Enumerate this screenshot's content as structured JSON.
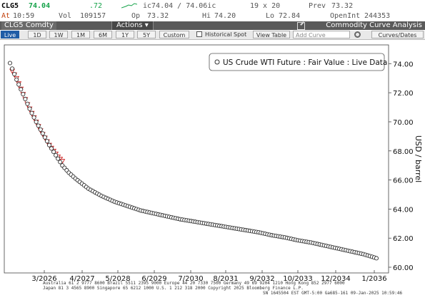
{
  "quote": {
    "ticker": "CLG5",
    "last": "74.04",
    "change": ".72",
    "ic_range": "ic74.04 / 74.06ic",
    "size": "19 x 20",
    "prev_label": "Prev",
    "prev_value": "73.32",
    "at_label": "At",
    "at_value": "10:59",
    "vol_label": "Vol",
    "vol_value": "109157",
    "op_label": "Op",
    "op_value": "73.32",
    "hi_label": "Hi",
    "hi_value": "74.20",
    "lo_label": "Lo",
    "lo_value": "72.84",
    "oi_label": "OpenInt",
    "oi_value": "244353"
  },
  "titlebar": {
    "security": "CLG5 Comdty",
    "actions": "Actions ▾",
    "app_title": "Commodity Curve Analysis"
  },
  "toolbar": {
    "periods": [
      "Live",
      "1D",
      "1W",
      "1M",
      "6M",
      "1Y",
      "5Y",
      "Custom"
    ],
    "active_period": "Live",
    "historical_spot": "Historical Spot",
    "view_table": "View Table",
    "add_curve_placeholder": "Add Curve",
    "curves_dates": "Curves/Dates"
  },
  "colors": {
    "live_marker": "#333333",
    "historical_marker": "#cc2222",
    "active_button": "#1f5ca6",
    "last_price": "#16a34a"
  },
  "chart_data": {
    "type": "line",
    "ylabel": "USD / barrel",
    "ylim": [
      60,
      74.8
    ],
    "yticks": [
      "60.00",
      "62.00",
      "64.00",
      "66.00",
      "68.00",
      "70.00",
      "72.00",
      "74.00"
    ],
    "xticks": [
      "3/2026",
      "4/2027",
      "5/2028",
      "6/2029",
      "7/2030",
      "8/2031",
      "9/2032",
      "10/2033",
      "12/2034",
      "1/2036"
    ],
    "grid": false,
    "legend_position": "top-right",
    "series": [
      {
        "name": "US Crude WTI Future : Fair Value : Live Data",
        "marker": "circle",
        "points": [
          [
            0,
            74.04
          ],
          [
            3,
            72.9
          ],
          [
            6,
            71.9
          ],
          [
            9,
            70.9
          ],
          [
            12,
            70.0
          ],
          [
            15,
            69.2
          ],
          [
            18,
            68.4
          ],
          [
            21,
            67.7
          ],
          [
            24,
            67.0
          ],
          [
            27,
            66.5
          ],
          [
            30,
            66.1
          ],
          [
            36,
            65.4
          ],
          [
            42,
            64.9
          ],
          [
            48,
            64.5
          ],
          [
            54,
            64.2
          ],
          [
            60,
            63.9
          ],
          [
            66,
            63.7
          ],
          [
            72,
            63.5
          ],
          [
            78,
            63.3
          ],
          [
            84,
            63.15
          ],
          [
            90,
            63.0
          ],
          [
            96,
            62.85
          ],
          [
            102,
            62.7
          ],
          [
            108,
            62.55
          ],
          [
            114,
            62.4
          ],
          [
            120,
            62.2
          ],
          [
            126,
            62.05
          ],
          [
            132,
            61.85
          ],
          [
            138,
            61.7
          ],
          [
            144,
            61.5
          ],
          [
            150,
            61.3
          ],
          [
            156,
            61.1
          ],
          [
            162,
            60.9
          ],
          [
            166,
            60.72
          ],
          [
            168,
            60.62
          ]
        ]
      },
      {
        "name": "",
        "marker": "triangle-down",
        "points": [
          [
            1,
            73.4
          ],
          [
            3,
            72.9
          ],
          [
            6,
            71.8
          ],
          [
            8,
            71.1
          ],
          [
            10,
            70.5
          ],
          [
            12,
            69.9
          ],
          [
            14,
            69.3
          ],
          [
            16,
            68.8
          ],
          [
            18,
            68.3
          ],
          [
            20,
            67.9
          ],
          [
            22,
            67.5
          ],
          [
            24,
            67.2
          ]
        ]
      }
    ]
  },
  "footer": {
    "line1": "Australia 61 2 9777 8600 Brazil 5511 2395 9000 Europe 44 20 7330 7500 Germany 49 69 9204 1210 Hong Kong 852 2977 6000",
    "line2": "Japan 81 3 4565 8900       Singapore 65 6212 1000       U.S. 1 212 318 2000             Copyright 2025 Bloomberg Finance L.P.",
    "line3": "SN 1645504 EST  GMT-5:00 Ga685-161 09-Jan-2025 10:59:46"
  }
}
